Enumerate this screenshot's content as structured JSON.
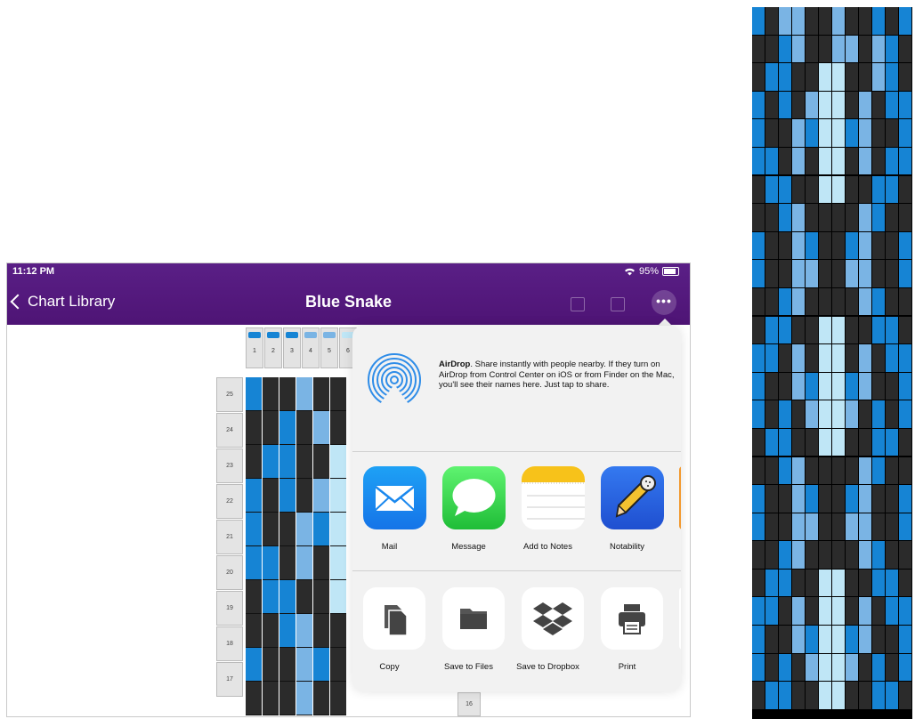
{
  "status": {
    "time": "11:12 PM",
    "battery": "95%"
  },
  "nav": {
    "back_label": "Chart Library",
    "title": "Blue Snake",
    "more_label": "•••"
  },
  "colors": {
    "dark": "#2b2b2b",
    "blue": "#1684d4",
    "mid": "#7ab4e4",
    "light": "#bfe6f6",
    "nav_purple": "#55187f"
  },
  "grid": {
    "column_numbers": [
      "1",
      "2",
      "3",
      "4",
      "5",
      "6"
    ],
    "column_swatches": [
      "blue",
      "blue",
      "blue",
      "mid",
      "mid",
      "light"
    ],
    "row_labels": [
      "25",
      "24",
      "23",
      "22",
      "21",
      "20",
      "19",
      "18",
      "17"
    ],
    "extra_row_label": "16",
    "rows": [
      [
        "blue",
        "dark",
        "dark",
        "mid",
        "dark",
        "dark"
      ],
      [
        "dark",
        "dark",
        "blue",
        "dark",
        "mid",
        "dark"
      ],
      [
        "dark",
        "blue",
        "blue",
        "dark",
        "dark",
        "light"
      ],
      [
        "blue",
        "dark",
        "blue",
        "dark",
        "mid",
        "light"
      ],
      [
        "blue",
        "dark",
        "dark",
        "mid",
        "blue",
        "light"
      ],
      [
        "blue",
        "blue",
        "dark",
        "mid",
        "dark",
        "light"
      ],
      [
        "dark",
        "blue",
        "blue",
        "dark",
        "dark",
        "light"
      ],
      [
        "dark",
        "dark",
        "blue",
        "mid",
        "dark",
        "dark"
      ],
      [
        "blue",
        "dark",
        "dark",
        "mid",
        "blue",
        "dark"
      ],
      [
        "dark",
        "dark",
        "dark",
        "mid",
        "dark",
        "dark"
      ]
    ]
  },
  "share": {
    "airdrop_title": "AirDrop",
    "airdrop_text": ". Share instantly with people nearby. If they turn on AirDrop from Control Center on iOS or from Finder on the Mac, you'll see their names here. Just tap to share.",
    "apps": [
      {
        "label": "Mail",
        "icon": "mail-icon"
      },
      {
        "label": "Message",
        "icon": "message-icon"
      },
      {
        "label": "Add to Notes",
        "icon": "notes-icon"
      },
      {
        "label": "Notability",
        "icon": "notability-icon"
      }
    ],
    "actions": [
      {
        "label": "Copy",
        "icon": "copy-icon"
      },
      {
        "label": "Save to Files",
        "icon": "folder-icon"
      },
      {
        "label": "Save to Dropbox",
        "icon": "dropbox-icon"
      },
      {
        "label": "Print",
        "icon": "printer-icon"
      }
    ]
  },
  "strip": {
    "rows": [
      [
        "blue",
        "dark",
        "mid",
        "mid",
        "dark",
        "dark",
        "mid",
        "dark",
        "dark",
        "blue",
        "dark",
        "blue"
      ],
      [
        "dark",
        "dark",
        "blue",
        "mid",
        "dark",
        "dark",
        "mid",
        "mid",
        "dark",
        "mid",
        "blue",
        "dark"
      ],
      [
        "dark",
        "blue",
        "blue",
        "dark",
        "dark",
        "light",
        "light",
        "dark",
        "dark",
        "mid",
        "blue",
        "dark"
      ],
      [
        "blue",
        "dark",
        "blue",
        "dark",
        "mid",
        "light",
        "light",
        "dark",
        "mid",
        "dark",
        "blue",
        "blue"
      ],
      [
        "blue",
        "dark",
        "dark",
        "mid",
        "blue",
        "light",
        "light",
        "blue",
        "mid",
        "dark",
        "dark",
        "blue"
      ],
      [
        "blue",
        "blue",
        "dark",
        "mid",
        "dark",
        "light",
        "light",
        "dark",
        "mid",
        "dark",
        "blue",
        "blue"
      ],
      [
        "dark",
        "blue",
        "blue",
        "dark",
        "dark",
        "light",
        "light",
        "dark",
        "dark",
        "blue",
        "blue",
        "dark"
      ],
      [
        "dark",
        "dark",
        "blue",
        "mid",
        "dark",
        "dark",
        "dark",
        "dark",
        "mid",
        "blue",
        "dark",
        "dark"
      ],
      [
        "blue",
        "dark",
        "dark",
        "mid",
        "blue",
        "dark",
        "dark",
        "blue",
        "mid",
        "dark",
        "dark",
        "blue"
      ],
      [
        "blue",
        "dark",
        "dark",
        "mid",
        "mid",
        "dark",
        "dark",
        "mid",
        "mid",
        "dark",
        "dark",
        "blue"
      ],
      [
        "dark",
        "dark",
        "blue",
        "mid",
        "dark",
        "dark",
        "dark",
        "dark",
        "mid",
        "blue",
        "dark",
        "dark"
      ],
      [
        "dark",
        "blue",
        "blue",
        "dark",
        "dark",
        "light",
        "light",
        "dark",
        "dark",
        "blue",
        "blue",
        "dark"
      ],
      [
        "blue",
        "blue",
        "dark",
        "mid",
        "dark",
        "light",
        "light",
        "dark",
        "mid",
        "dark",
        "blue",
        "blue"
      ],
      [
        "blue",
        "dark",
        "dark",
        "mid",
        "blue",
        "light",
        "light",
        "blue",
        "mid",
        "dark",
        "dark",
        "blue"
      ],
      [
        "blue",
        "dark",
        "blue",
        "dark",
        "mid",
        "light",
        "light",
        "mid",
        "dark",
        "blue",
        "dark",
        "blue"
      ],
      [
        "dark",
        "blue",
        "blue",
        "dark",
        "dark",
        "light",
        "light",
        "dark",
        "dark",
        "blue",
        "blue",
        "dark"
      ],
      [
        "dark",
        "dark",
        "blue",
        "mid",
        "dark",
        "dark",
        "dark",
        "dark",
        "mid",
        "blue",
        "dark",
        "dark"
      ],
      [
        "blue",
        "dark",
        "dark",
        "mid",
        "blue",
        "dark",
        "dark",
        "blue",
        "mid",
        "dark",
        "dark",
        "blue"
      ],
      [
        "blue",
        "dark",
        "dark",
        "mid",
        "mid",
        "dark",
        "dark",
        "mid",
        "mid",
        "dark",
        "dark",
        "blue"
      ],
      [
        "dark",
        "dark",
        "blue",
        "mid",
        "dark",
        "dark",
        "dark",
        "dark",
        "mid",
        "blue",
        "dark",
        "dark"
      ],
      [
        "dark",
        "blue",
        "blue",
        "dark",
        "dark",
        "light",
        "light",
        "dark",
        "dark",
        "blue",
        "blue",
        "dark"
      ],
      [
        "blue",
        "blue",
        "dark",
        "mid",
        "dark",
        "light",
        "light",
        "dark",
        "mid",
        "dark",
        "blue",
        "blue"
      ],
      [
        "blue",
        "dark",
        "dark",
        "mid",
        "blue",
        "light",
        "light",
        "blue",
        "mid",
        "dark",
        "dark",
        "blue"
      ],
      [
        "blue",
        "dark",
        "blue",
        "dark",
        "mid",
        "light",
        "light",
        "mid",
        "dark",
        "blue",
        "dark",
        "blue"
      ],
      [
        "dark",
        "blue",
        "blue",
        "dark",
        "dark",
        "light",
        "light",
        "dark",
        "dark",
        "blue",
        "blue",
        "dark"
      ]
    ]
  }
}
